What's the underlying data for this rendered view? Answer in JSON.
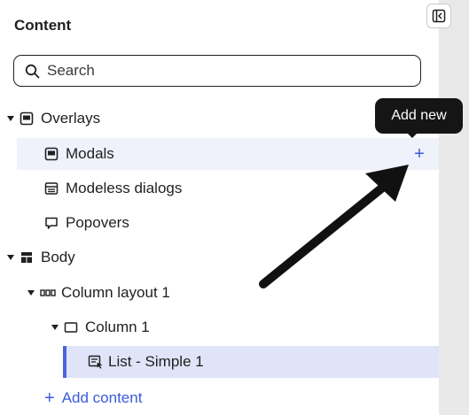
{
  "panel": {
    "title": "Content",
    "collapse_icon": "collapse-panel-icon"
  },
  "search": {
    "placeholder": "Search",
    "value": ""
  },
  "tree": {
    "overlays": {
      "label": "Overlays",
      "icon": "overlay-icon",
      "expanded": true
    },
    "modals": {
      "label": "Modals",
      "icon": "modal-icon",
      "hover": true
    },
    "modeless": {
      "label": "Modeless dialogs",
      "icon": "modeless-dialog-icon"
    },
    "popovers": {
      "label": "Popovers",
      "icon": "popover-icon"
    },
    "body": {
      "label": "Body",
      "icon": "body-layout-icon",
      "expanded": true
    },
    "column_layout": {
      "label": "Column layout 1",
      "icon": "column-layout-icon",
      "expanded": true
    },
    "column": {
      "label": "Column 1",
      "icon": "column-icon",
      "expanded": true
    },
    "list": {
      "label": "List - Simple 1",
      "icon": "list-icon",
      "selected": true
    }
  },
  "add_content": {
    "label": "Add content"
  },
  "tooltip": {
    "text": "Add new"
  },
  "colors": {
    "accent": "#3b5bdb",
    "selected_bg": "#dfe4f8",
    "hover_bg": "#eff1fb",
    "tooltip_bg": "#151515"
  }
}
